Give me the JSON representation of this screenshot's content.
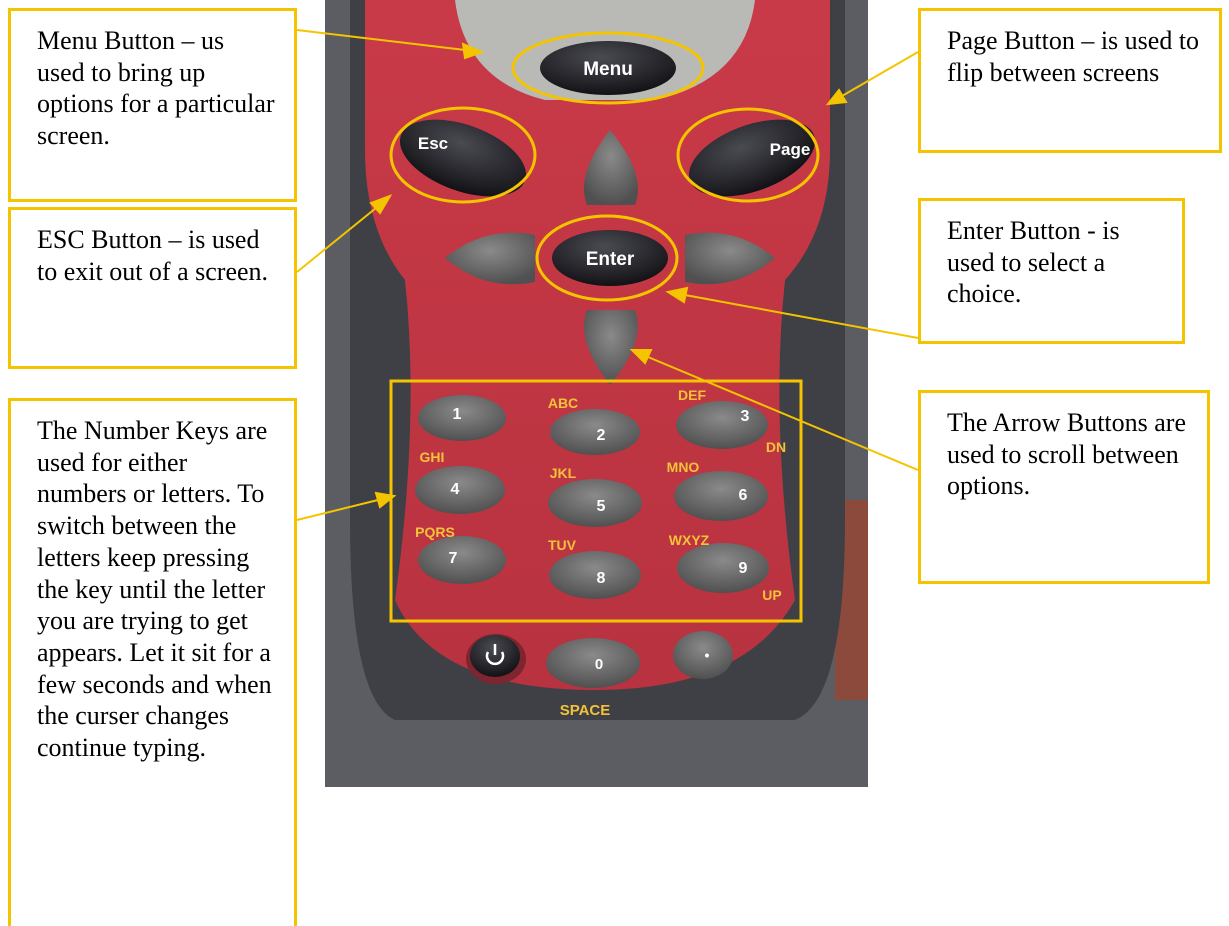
{
  "callouts": {
    "menu": "Menu Button – us used to bring up options for a particular screen.",
    "esc": "ESC Button – is used to exit out of a screen.",
    "number_keys": "The Number Keys are used for either numbers or letters. To switch between the letters keep pressing the key until the letter you are trying to get appears. Let it sit for a few seconds and when the curser changes continue typing.",
    "page": "Page Button – is used to flip between screens",
    "enter": "Enter Button - is used to select a choice.",
    "arrows": "The Arrow Buttons are used to scroll between options."
  },
  "keypad": {
    "menu": "Menu",
    "esc": "Esc",
    "page": "Page",
    "enter": "Enter",
    "keys": [
      {
        "digit": "1",
        "letters": ""
      },
      {
        "digit": "2",
        "letters": "ABC"
      },
      {
        "digit": "3",
        "letters": "DEF",
        "extra": "DN"
      },
      {
        "digit": "4",
        "letters": "GHI"
      },
      {
        "digit": "5",
        "letters": "JKL"
      },
      {
        "digit": "6",
        "letters": "MNO"
      },
      {
        "digit": "7",
        "letters": "PQRS"
      },
      {
        "digit": "8",
        "letters": "TUV"
      },
      {
        "digit": "9",
        "letters": "WXYZ",
        "extra": "UP"
      },
      {
        "digit": "0",
        "letters": "SPACE"
      },
      {
        "digit": "•",
        "letters": ""
      }
    ]
  },
  "colors": {
    "callout_border": "#f5c400",
    "device_red": "#c8404c",
    "device_grey": "#4a4a50",
    "key_grey": "#6a6a6a",
    "key_black": "#1d1d22"
  }
}
